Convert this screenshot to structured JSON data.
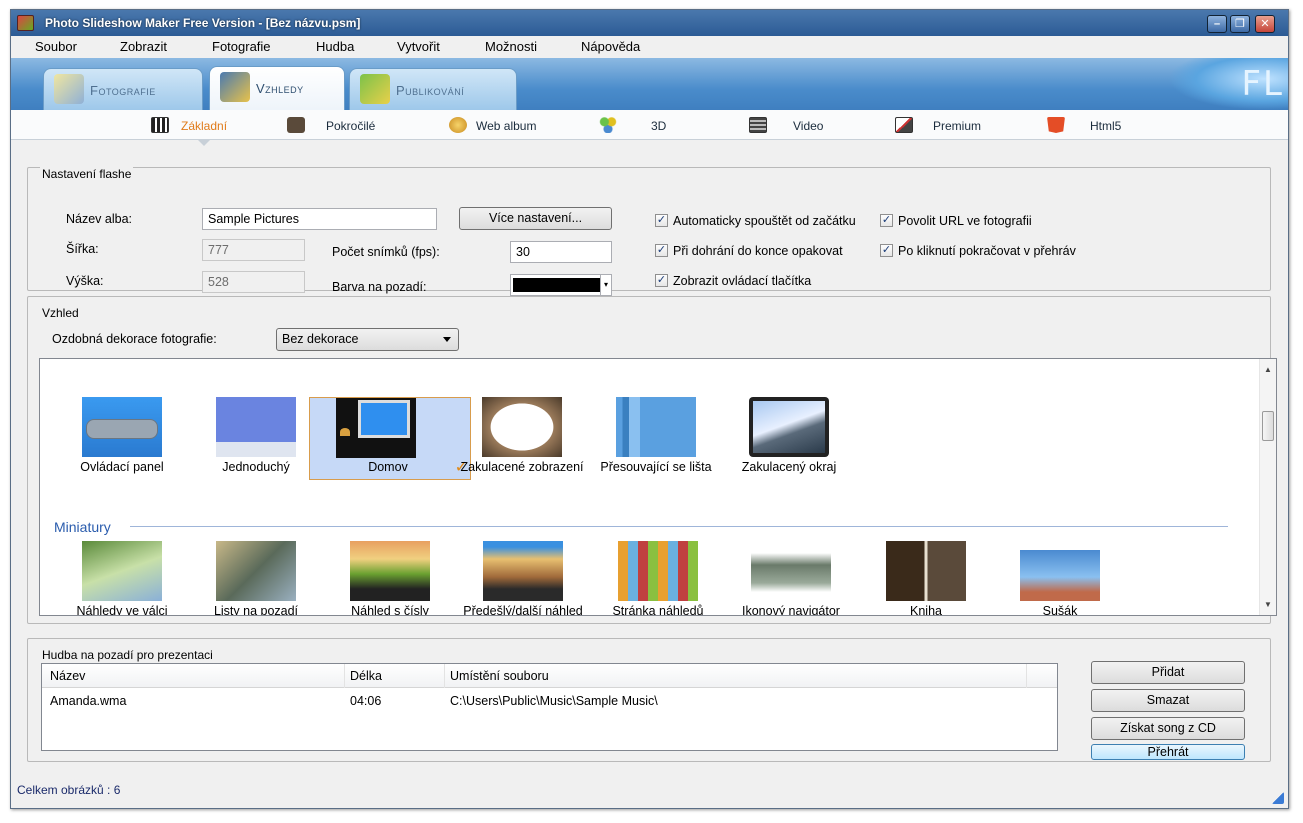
{
  "window": {
    "title": "Photo Slideshow Maker Free Version - [Bez názvu.psm]"
  },
  "menu": [
    "Soubor",
    "Zobrazit",
    "Fotografie",
    "Hudba",
    "Vytvořit",
    "Možnosti",
    "Nápověda"
  ],
  "main_tabs": [
    {
      "label": "Fotografie",
      "active": false
    },
    {
      "label": "Vzhledy",
      "active": true
    },
    {
      "label": "Publikování",
      "active": false
    }
  ],
  "sub_tabs": [
    {
      "label": "Základní",
      "icon": "piano-icon",
      "active": true
    },
    {
      "label": "Pokročilé",
      "icon": "briefcase-icon",
      "active": false
    },
    {
      "label": "Web album",
      "icon": "web-album-icon",
      "active": false
    },
    {
      "label": "3D",
      "icon": "molecule-icon",
      "active": false
    },
    {
      "label": "Video",
      "icon": "film-icon",
      "active": false
    },
    {
      "label": "Premium",
      "icon": "premium-icon",
      "active": false
    },
    {
      "label": "Html5",
      "icon": "html5-icon",
      "active": false
    }
  ],
  "flash_settings": {
    "group_title": "Nastavení flashe",
    "album_name_label": "Název alba:",
    "album_name_value": "Sample Pictures",
    "width_label": "Šířka:",
    "width_value": "777",
    "height_label": "Výška:",
    "height_value": "528",
    "fps_label": "Počet snímků (fps):",
    "fps_value": "30",
    "bg_color_label": "Barva na pozadí:",
    "bg_color": "#000000",
    "more_settings_button": "Více nastavení...",
    "checkboxes": [
      {
        "label": "Automaticky spouštět od začátku",
        "checked": true
      },
      {
        "label": "Při dohrání do konce opakovat",
        "checked": true
      },
      {
        "label": "Zobrazit ovládací tlačítka",
        "checked": true
      },
      {
        "label": "Povolit URL ve fotografii",
        "checked": true
      },
      {
        "label": "Po kliknutí pokračovat v přehráv",
        "checked": true
      }
    ]
  },
  "appearance": {
    "group_title": "Vzhled",
    "decoration_label": "Ozdobná dekorace fotografie:",
    "decoration_value": "Bez dekorace",
    "templates": [
      {
        "label": "Ovládací panel",
        "selected": false
      },
      {
        "label": "Jednoduchý",
        "selected": false
      },
      {
        "label": "Domov",
        "selected": true
      },
      {
        "label": "Zakulacené zobrazení",
        "selected": false
      },
      {
        "label": "Přesouvající se lišta",
        "selected": false
      },
      {
        "label": "Zakulacený okraj",
        "selected": false
      }
    ],
    "thumbnails_section_title": "Miniatury",
    "thumbnail_templates": [
      {
        "label": "Náhledy ve válci"
      },
      {
        "label": "Listy na pozadí"
      },
      {
        "label": "Náhled s čísly"
      },
      {
        "label": "Předešlý/další náhled"
      },
      {
        "label": "Stránka náhledů"
      },
      {
        "label": "Ikonový navigátor"
      },
      {
        "label": "Kniha"
      },
      {
        "label": "Sušák"
      }
    ]
  },
  "music": {
    "group_title": "Hudba na pozadí pro prezentaci",
    "columns": [
      "Název",
      "Délka",
      "Umístění souboru"
    ],
    "rows": [
      {
        "name": "Amanda.wma",
        "length": "04:06",
        "path": "C:\\Users\\Public\\Music\\Sample Music\\"
      }
    ],
    "buttons": {
      "add": "Přidat",
      "delete": "Smazat",
      "get_cd": "Získat song z CD",
      "play": "Přehrát"
    }
  },
  "status": {
    "total_images": "Celkem obrázků : 6"
  }
}
